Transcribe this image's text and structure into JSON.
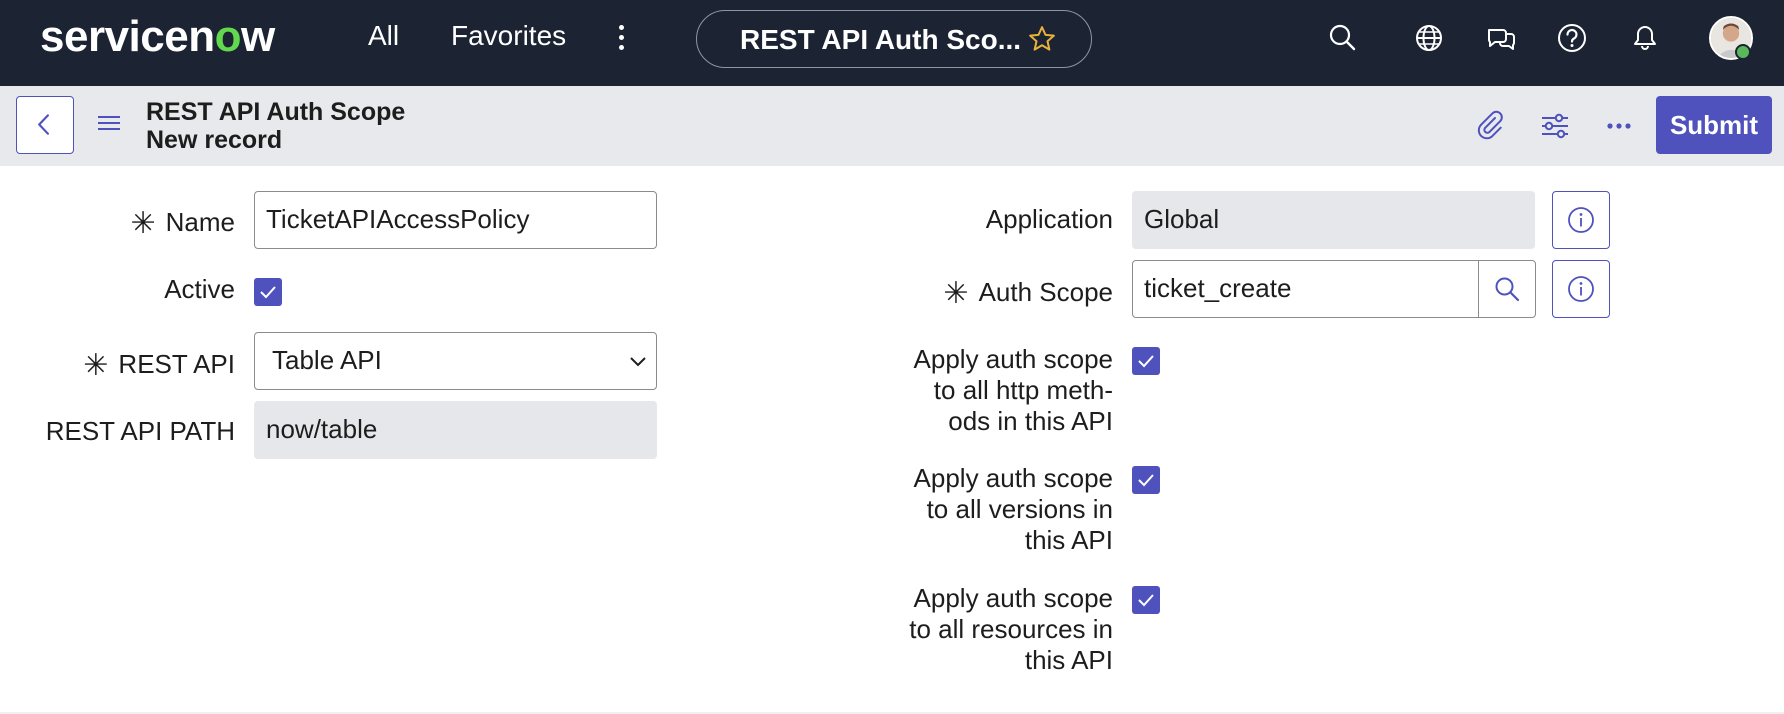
{
  "topnav": {
    "logo_pre": "servicen",
    "logo_o": "o",
    "logo_post": "w",
    "all_label": "All",
    "favorites_label": "Favorites",
    "context_title": "REST API Auth Sco...",
    "icons": [
      "search-icon",
      "globe-icon",
      "chat-icon",
      "help-icon",
      "bell-icon"
    ]
  },
  "form_header": {
    "title": "REST API Auth Scope",
    "subtitle": "New record",
    "submit_label": "Submit",
    "icons": [
      "attachment-icon",
      "personalize-icon",
      "more-icon"
    ]
  },
  "form": {
    "name": {
      "label": "Name",
      "value": "TicketAPIAccessPolicy",
      "required": true
    },
    "active": {
      "label": "Active",
      "checked": true
    },
    "rest_api": {
      "label": "REST API",
      "value": "Table API",
      "required": true
    },
    "rest_api_path": {
      "label": "REST API PATH",
      "value": "now/table"
    },
    "application": {
      "label": "Application",
      "value": "Global"
    },
    "auth_scope": {
      "label": "Auth Scope",
      "value": "ticket_create",
      "required": true
    },
    "apply_http_methods": {
      "label": "Apply auth scope to all http meth- ods in this API",
      "line1": "Apply auth scope",
      "line2": "to all http meth-",
      "line3": "ods in this API",
      "checked": true
    },
    "apply_versions": {
      "label": "Apply auth scope to all versions in this API",
      "line1": "Apply auth scope",
      "line2": "to all versions in",
      "line3": "this API",
      "checked": true
    },
    "apply_resources": {
      "label": "Apply auth scope to all resources in this API",
      "line1": "Apply auth scope",
      "line2": "to all resources in",
      "line3": "this API",
      "checked": true
    }
  },
  "colors": {
    "nav_bg": "#1c2333",
    "accent": "#4f52bd",
    "logo_accent": "#62d84e",
    "header_bg": "#e8e9ec",
    "readonly_bg": "#e6e7ea"
  }
}
